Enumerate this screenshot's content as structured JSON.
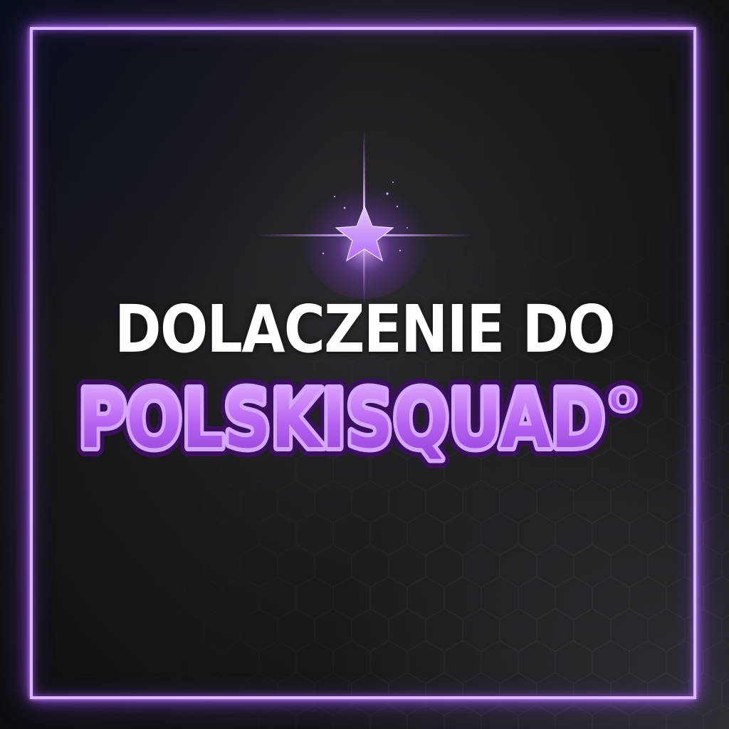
{
  "poster": {
    "line1": "DOLACZENIE DO",
    "line2": "POLSKISQUAD",
    "line2_suffix": "o"
  },
  "colors": {
    "background": "#1b1b1e",
    "frame": "#d9b8ff",
    "frame_glow": "#a45aff",
    "star": "#c27cff",
    "title_white": "#ffffff",
    "title_purple": "#b562f0",
    "title_outline": "#5a1f86"
  },
  "icons": {
    "star": "sparkle-star-icon"
  }
}
